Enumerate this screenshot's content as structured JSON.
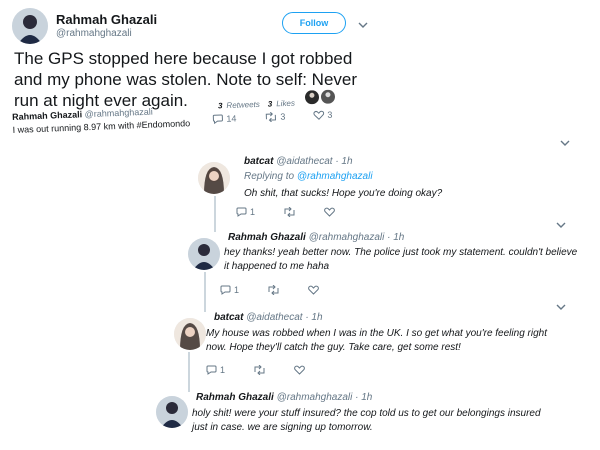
{
  "main_tweet": {
    "author_name": "Rahmah Ghazali",
    "author_handle": "@rahmahghazali",
    "follow_label": "Follow",
    "text_line1": "The GPS stopped here because I got robbed",
    "text_line2": "and my phone was stolen. Note to self: Never",
    "text_line3": "run at night ever again.",
    "retweets_count": "3",
    "retweets_label": "Retweets",
    "likes_count": "3",
    "likes_label": "Likes"
  },
  "quoted_card": {
    "name": "Rahmah Ghazali",
    "handle": "@rahmahghazali",
    "text": "I was out running 8.97 km with #Endomondo",
    "replies": "14",
    "retweets": "3",
    "likes": "3"
  },
  "replies": [
    {
      "name": "batcat",
      "handle": "@aidathecat",
      "time": "· 1h",
      "replying_prefix": "Replying to",
      "replying_to": "@rahmahghazali",
      "line1": "Oh shit, that sucks! Hope you're doing okay?",
      "line2": "",
      "reply_count": "1",
      "retweet_count": "",
      "like_count": ""
    },
    {
      "name": "Rahmah Ghazali",
      "handle": "@rahmahghazali",
      "time": "· 1h",
      "line1": "hey thanks! yeah better now. The police just took my statement. couldn't believe",
      "line2": "it happened to me haha",
      "reply_count": "1",
      "retweet_count": "",
      "like_count": ""
    },
    {
      "name": "batcat",
      "handle": "@aidathecat",
      "time": "· 1h",
      "line1": "My house was robbed when I was in the UK. I so get what you're feeling right",
      "line2": "now. Hope they'll catch the guy. Take care, get some rest!",
      "reply_count": "1",
      "retweet_count": "",
      "like_count": ""
    },
    {
      "name": "Rahmah Ghazali",
      "handle": "@rahmahghazali",
      "time": "· 1h",
      "line1": "holy shit! were your stuff insured? the cop told us to get our belongings insured",
      "line2": "just in case. we are signing up tomorrow."
    }
  ],
  "colors": {
    "link": "#1da1f2",
    "muted": "#657786",
    "follow_border": "#1da1f2"
  }
}
